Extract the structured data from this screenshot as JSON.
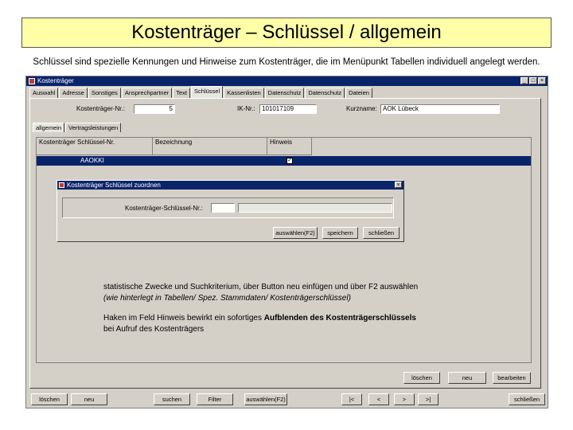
{
  "slide": {
    "title": "Kostenträger – Schlüssel / allgemein",
    "subtitle": "Schlüssel sind spezielle Kennungen und Hinweise zum Kostenträger, die im Menüpunkt Tabellen individuell angelegt werden."
  },
  "window": {
    "title": "Kostenträger",
    "min": "_",
    "max": "□",
    "close": "×"
  },
  "tabs": [
    "Auswahl",
    "Adresse",
    "Sonstiges",
    "Ansprechpartner",
    "Text",
    "Schlüssel",
    "Kassenlisten",
    "Datenschutz",
    "Datenschutz",
    "Dateien"
  ],
  "header": {
    "kt_nr_label": "Kostenträger-Nr.:",
    "kt_nr_value": "5",
    "ik_label": "IK-Nr.:",
    "ik_value": "101017109",
    "kurzname_label": "Kurzname:",
    "kurzname_value": "AOK Lübeck"
  },
  "subtabs": [
    "allgemein",
    "Vertragsleistungen"
  ],
  "grid": {
    "col1": "Kostenträger Schlüssel-Nr.",
    "col2": "Bezeichnung",
    "col3": "Hinweis",
    "row_key": "AAOKKI",
    "row_check": "✓"
  },
  "dialog": {
    "title": "Kostenträger Schlüssel zuordnen",
    "close": "×",
    "field_label": "Kostenträger-Schlüssel-Nr.:",
    "btn_select": "auswählen(F2)",
    "btn_save": "speichern",
    "btn_close": "schließen"
  },
  "notes": {
    "line1": "statistische Zwecke und Suchkriterium, über Button neu einfügen und über F2 auswählen",
    "line2": "(wie hinterlegt in Tabellen/ Spez. Stammdaten/ Kostenträgerschlüssel)",
    "line3a": "Haken im Feld Hinweis bewirkt ein sofortiges ",
    "line3b": "Aufblenden des Kostenträgerschlüssels",
    "line4": "bei Aufruf des Kostenträgers"
  },
  "bottom": {
    "loeschen": "löschen",
    "neu": "neu",
    "bearbeiten": "bearbeiten",
    "f_loeschen": "löschen",
    "f_neu": "neu",
    "f_suchen": "suchen",
    "f_filter": "Filter",
    "f_auswaehlen": "auswählen(F2)",
    "nav_first": "|<",
    "nav_prev": "<",
    "nav_next": ">",
    "nav_last": ">|",
    "f_schliessen": "schließen"
  }
}
